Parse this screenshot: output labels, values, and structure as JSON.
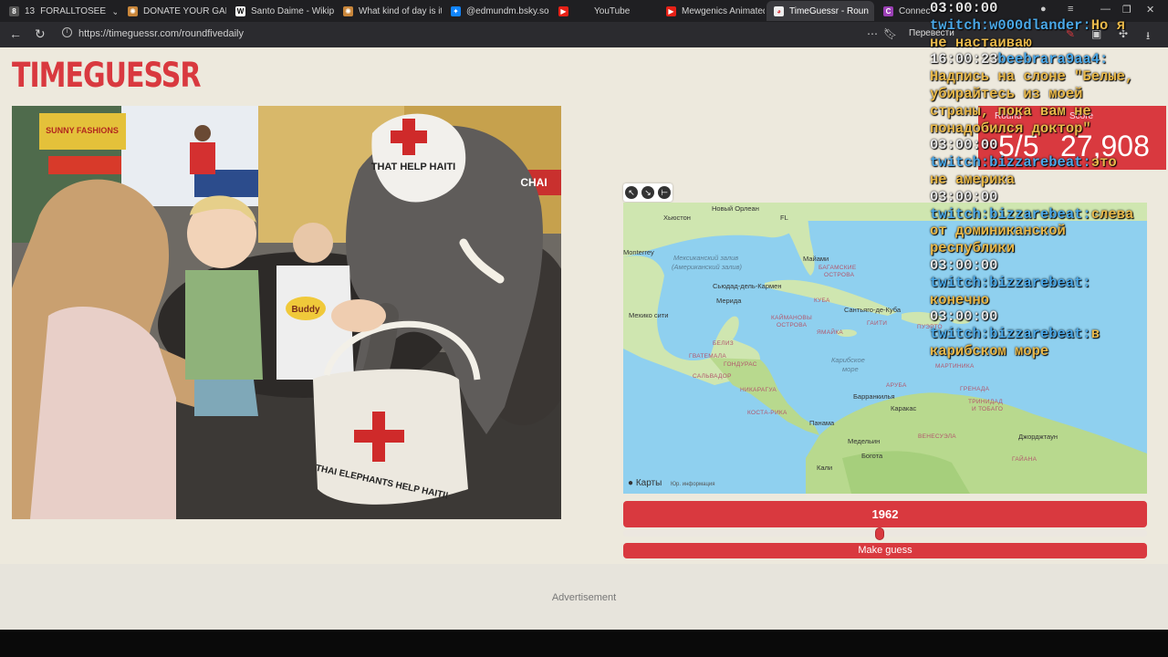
{
  "browser": {
    "tab_counter": "13",
    "tabs": [
      {
        "label": "FORALLTOSEE"
      },
      {
        "label": "DONATE YOUR GAME"
      },
      {
        "label": "Santo Daime - Wikipe"
      },
      {
        "label": "What kind of day is it?"
      },
      {
        "label": "@edmundm.bsky.soc"
      },
      {
        "label": "YouTube"
      },
      {
        "label": "Mewgenics Animated"
      },
      {
        "label": "TimeGuessr - Roun"
      },
      {
        "label": "Connectio"
      }
    ],
    "url": "https://timeguessr.com/roundfivedaily",
    "translate_label": "Перевести"
  },
  "page": {
    "logo": "TIMEGUESSR",
    "photo": {
      "texts": [
        "SUNNY FASHIONS",
        "Buddy",
        "THAT HELP HAITI",
        "THAI ELEPHANTS HELP HAITI!",
        "CHAI"
      ]
    },
    "map": {
      "labels": {
        "houston": "Хьюстон",
        "new_orleans": "Новый Орлеан",
        "fl": "FL",
        "monterrey": "Monterrey",
        "gulf": "Мексиканский залив",
        "gulf2": "(Американский залив)",
        "miami": "Майами",
        "bahamas": "БАГАМСКИЕ",
        "bahamas2": "ОСТРОВА",
        "ciudad": "Сьюдад-дель-Кармен",
        "merida": "Мерида",
        "cuba": "КУБА",
        "santiago": "Сантьяго-де-Куба",
        "mexico_city": "Мехико сити",
        "cayman": "КАЙМАНОВЫ",
        "cayman2": "ОСТРОВА",
        "haiti": "ГАИТИ",
        "jamaica": "ЯМАЙКА",
        "puerto": "ПУЭРТО",
        "belize": "БЕЛИЗ",
        "guatemala": "ГВАТЕМАЛА",
        "honduras": "ГОНДУРАС",
        "salvador": "САЛЬВАДОР",
        "nicaragua": "НИКАРАГУА",
        "caribbean": "Карибское",
        "caribbean2": "море",
        "aruba": "АРУБА",
        "martinique": "МАРТИНИКА",
        "grenada": "ГРЕНАДА",
        "barranquilla": "Барранкилья",
        "trinidad": "ТРИНИДАД",
        "trinidad2": "И ТОБАГО",
        "costa_rica": "КОСТА-РИКА",
        "panama": "Панама",
        "caracas": "Каракас",
        "venezuela": "ВЕНЕСУЭЛА",
        "georgetown": "Джорджтаун",
        "guyana": "ГАЙАНА",
        "medellin": "Медельин",
        "bogota": "Богота",
        "cali": "Кали"
      },
      "attribution": "Карты",
      "attribution_legal": "Юр. информация"
    },
    "year_value": "1962",
    "year_fraction": 0.49,
    "make_guess_label": "Make guess",
    "advertisement": "Advertisement",
    "score_panel": {
      "round_label": "Round",
      "score_label": "Score",
      "round_value": "5/5",
      "score_value": "27,908"
    }
  },
  "chat": [
    {
      "ts": "03:00:00",
      "user": "",
      "msg": ""
    },
    {
      "ts": "",
      "user": "twitch:w000dlander:",
      "msg": "Но я"
    },
    {
      "ts": "",
      "user": "",
      "msg": "не настаиваю"
    },
    {
      "ts": "16:00:23",
      "user": "beebrara9aa4:",
      "msg": ""
    },
    {
      "ts": "",
      "user": "",
      "msg": "Надпись на слоне \"Белые,"
    },
    {
      "ts": "",
      "user": "",
      "msg": "убирайтесь из моей"
    },
    {
      "ts": "",
      "user": "",
      "msg": "страны, пока вам не"
    },
    {
      "ts": "",
      "user": "",
      "msg": "понадобился доктор\""
    },
    {
      "ts": "03:00:00",
      "user": "",
      "msg": ""
    },
    {
      "ts": "",
      "user": "twitch:bizzarebeat:",
      "msg": "это"
    },
    {
      "ts": "",
      "user": "",
      "msg": "не америка"
    },
    {
      "ts": "03:00:00",
      "user": "",
      "msg": ""
    },
    {
      "ts": "",
      "user": "twitch:bizzarebeat:",
      "msg": "слева"
    },
    {
      "ts": "",
      "user": "",
      "msg": "от доминиканской"
    },
    {
      "ts": "",
      "user": "",
      "msg": "республики"
    },
    {
      "ts": "03:00:00",
      "user": "",
      "msg": ""
    },
    {
      "ts": "",
      "user": "twitch:bizzarebeat:",
      "msg": ""
    },
    {
      "ts": "",
      "user": "",
      "msg": "конечно"
    },
    {
      "ts": "03:00:00",
      "user": "",
      "msg": ""
    },
    {
      "ts": "",
      "user": "twitch:bizzarebeat:",
      "msg": "в"
    },
    {
      "ts": "",
      "user": "",
      "msg": "карибском море"
    }
  ],
  "colors": {
    "accent": "#d9393f",
    "page_bg": "#ede9dd",
    "chat_user": "#4aa8e8",
    "chat_msg": "#e8b84a"
  }
}
